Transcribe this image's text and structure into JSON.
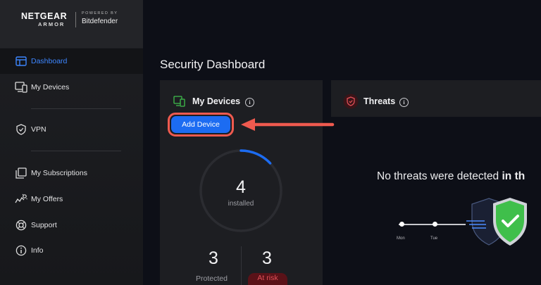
{
  "brand": {
    "name": "NETGEAR",
    "sub": "ARMOR",
    "powered_by": "POWERED BY",
    "partner": "Bitdefender"
  },
  "sidebar": {
    "items": [
      {
        "label": "Dashboard",
        "icon": "dashboard-icon",
        "active": true
      },
      {
        "label": "My Devices",
        "icon": "devices-icon"
      },
      {
        "label": "VPN",
        "icon": "vpn-shield-icon"
      },
      {
        "label": "My Subscriptions",
        "icon": "subscriptions-icon"
      },
      {
        "label": "My Offers",
        "icon": "offers-icon"
      },
      {
        "label": "Support",
        "icon": "support-icon"
      },
      {
        "label": "Info",
        "icon": "info-icon"
      }
    ]
  },
  "main": {
    "title": "Security Dashboard",
    "devices_card": {
      "title": "My Devices",
      "add_button": "Add Device",
      "installed_count": "4",
      "installed_label": "installed",
      "protected_count": "3",
      "protected_label": "Protected",
      "at_risk_count": "3",
      "at_risk_label": "At risk",
      "ring_progress": 0.13
    },
    "threats_card": {
      "title": "Threats",
      "message_plain": "No threats were detected",
      "message_bold": "in th",
      "days": [
        "Mon",
        "Tue"
      ]
    }
  },
  "colors": {
    "accent_blue": "#1c6cf2",
    "highlight_red": "#ef5a4f",
    "shield_green": "#3fbf4b",
    "at_risk_red": "#e05058"
  }
}
